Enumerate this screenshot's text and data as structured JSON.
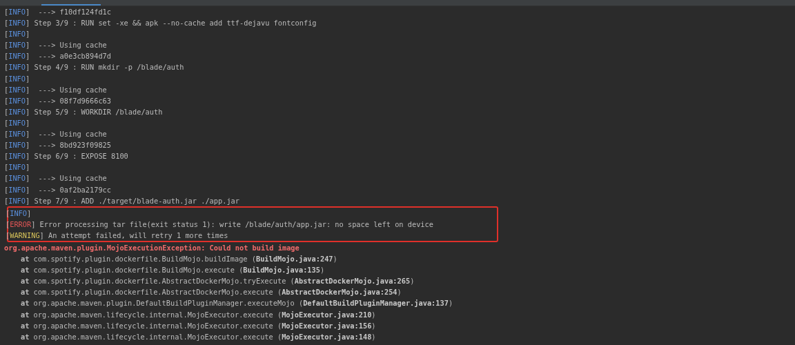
{
  "log": [
    {
      "kind": "log",
      "open": "[",
      "level": "INFO",
      "message": "]  ---> f10df124fd1c",
      "highlighted": false
    },
    {
      "kind": "log",
      "open": "[",
      "level": "INFO",
      "message": "] Step 3/9 : RUN set -xe && apk --no-cache add ttf-dejavu fontconfig",
      "highlighted": false
    },
    {
      "kind": "log",
      "open": "[",
      "level": "INFO",
      "message": "]",
      "highlighted": false
    },
    {
      "kind": "log",
      "open": "[",
      "level": "INFO",
      "message": "]  ---> Using cache",
      "highlighted": false
    },
    {
      "kind": "log",
      "open": "[",
      "level": "INFO",
      "message": "]  ---> a0e3cb894d7d",
      "highlighted": false
    },
    {
      "kind": "log",
      "open": "[",
      "level": "INFO",
      "message": "] Step 4/9 : RUN mkdir -p /blade/auth",
      "highlighted": false
    },
    {
      "kind": "log",
      "open": "[",
      "level": "INFO",
      "message": "]",
      "highlighted": false
    },
    {
      "kind": "log",
      "open": "[",
      "level": "INFO",
      "message": "]  ---> Using cache",
      "highlighted": false
    },
    {
      "kind": "log",
      "open": "[",
      "level": "INFO",
      "message": "]  ---> 08f7d9666c63",
      "highlighted": false
    },
    {
      "kind": "log",
      "open": "[",
      "level": "INFO",
      "message": "] Step 5/9 : WORKDIR /blade/auth",
      "highlighted": false
    },
    {
      "kind": "log",
      "open": "[",
      "level": "INFO",
      "message": "]",
      "highlighted": false
    },
    {
      "kind": "log",
      "open": "[",
      "level": "INFO",
      "message": "]  ---> Using cache",
      "highlighted": false
    },
    {
      "kind": "log",
      "open": "[",
      "level": "INFO",
      "message": "]  ---> 8bd923f09825",
      "highlighted": false
    },
    {
      "kind": "log",
      "open": "[",
      "level": "INFO",
      "message": "] Step 6/9 : EXPOSE 8100",
      "highlighted": false
    },
    {
      "kind": "log",
      "open": "[",
      "level": "INFO",
      "message": "]",
      "highlighted": false
    },
    {
      "kind": "log",
      "open": "[",
      "level": "INFO",
      "message": "]  ---> Using cache",
      "highlighted": false
    },
    {
      "kind": "log",
      "open": "[",
      "level": "INFO",
      "message": "]  ---> 0af2ba2179cc",
      "highlighted": false
    },
    {
      "kind": "log",
      "open": "[",
      "level": "INFO",
      "message": "] Step 7/9 : ADD ./target/blade-auth.jar ./app.jar",
      "highlighted": false
    },
    {
      "kind": "log",
      "open": "[",
      "level": "INFO",
      "message": "]",
      "highlighted": true
    },
    {
      "kind": "log",
      "open": "[",
      "level": "ERROR",
      "message": "] Error processing tar file(exit status 1): write /blade/auth/app.jar: no space left on device",
      "highlighted": true
    },
    {
      "kind": "log",
      "open": "[",
      "level": "WARNING",
      "message": "] An attempt failed, will retry 1 more times",
      "highlighted": true
    },
    {
      "kind": "exception",
      "text": "org.apache.maven.plugin.MojoExecutionException: Could not build image",
      "highlighted": false
    },
    {
      "kind": "frame",
      "at": "at",
      "method": "com.spotify.plugin.dockerfile.BuildMojo.buildImage",
      "location": "(**BuildMojo.java:247**)",
      "highlighted": false
    },
    {
      "kind": "frame",
      "at": "at",
      "method": "com.spotify.plugin.dockerfile.BuildMojo.execute",
      "location": "(**BuildMojo.java:135**)",
      "highlighted": false
    },
    {
      "kind": "frame",
      "at": "at",
      "method": "com.spotify.plugin.dockerfile.AbstractDockerMojo.tryExecute",
      "location": "(**AbstractDockerMojo.java:265**)",
      "highlighted": false
    },
    {
      "kind": "frame",
      "at": "at",
      "method": "com.spotify.plugin.dockerfile.AbstractDockerMojo.execute",
      "location": "(**AbstractDockerMojo.java:254**)",
      "highlighted": false
    },
    {
      "kind": "frame",
      "at": "at",
      "method": "org.apache.maven.plugin.DefaultBuildPluginManager.executeMojo",
      "location": "(**DefaultBuildPluginManager.java:137**)",
      "highlighted": false
    },
    {
      "kind": "frame",
      "at": "at",
      "method": "org.apache.maven.lifecycle.internal.MojoExecutor.execute",
      "location": "(**MojoExecutor.java:210**)",
      "highlighted": false
    },
    {
      "kind": "frame",
      "at": "at",
      "method": "org.apache.maven.lifecycle.internal.MojoExecutor.execute",
      "location": "(**MojoExecutor.java:156**)",
      "highlighted": false
    },
    {
      "kind": "frame",
      "at": "at",
      "method": "org.apache.maven.lifecycle.internal.MojoExecutor.execute",
      "location": "(**MojoExecutor.java:148**)",
      "highlighted": false
    }
  ]
}
